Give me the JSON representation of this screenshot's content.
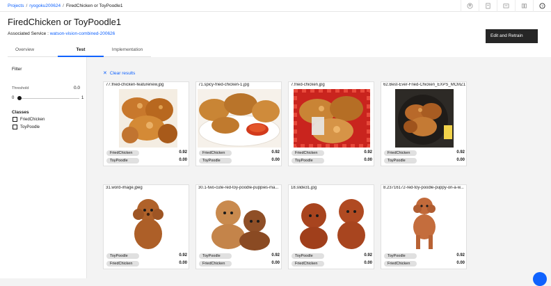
{
  "breadcrumb": {
    "projects": "Projects",
    "account": "ryogoku200624",
    "current": "FiredChicken or ToyPoodle1",
    "sep": "/"
  },
  "header": {
    "title": "FiredChicken or ToyPoodle1",
    "assoc_label": "Associated Service :",
    "assoc_link": "watson-vision-combined-200626",
    "retrain_label": "Edit and Retrain"
  },
  "tabs": [
    {
      "label": "Overview"
    },
    {
      "label": "Test"
    },
    {
      "label": "Implementation"
    }
  ],
  "topbar_icons": [
    "user-icon",
    "docs-icon",
    "messages-icon",
    "catalog-icon",
    "help-icon"
  ],
  "filter": {
    "title": "Filter",
    "threshold_label": "Threshold",
    "threshold_value": "0.0",
    "min": "0",
    "max": "1",
    "classes_title": "Classes",
    "classes": [
      {
        "label": "FriedChicken"
      },
      {
        "label": "ToyPoodle"
      }
    ]
  },
  "clear_label": "Clear results",
  "cards": [
    {
      "filename": "77.fried-chicken-featurenew.jpg",
      "results": [
        {
          "label": "FriedChicken",
          "score": "0.92"
        },
        {
          "label": "ToyPoodle",
          "score": "0.00"
        }
      ]
    },
    {
      "filename": "71.spicy-fried-chicken-1.jpg",
      "results": [
        {
          "label": "FriedChicken",
          "score": "0.92"
        },
        {
          "label": "ToyPoodle",
          "score": "0.00"
        }
      ]
    },
    {
      "filename": "7.fried-chicken.jpg",
      "results": [
        {
          "label": "FriedChicken",
          "score": "0.92"
        },
        {
          "label": "ToyPoodle",
          "score": "0.00"
        }
      ]
    },
    {
      "filename": "62.Best-Ever-Fried-Chicken_EXPS_MCMZ1...",
      "results": [
        {
          "label": "FriedChicken",
          "score": "0.92"
        },
        {
          "label": "ToyPoodle",
          "score": "0.00"
        }
      ]
    },
    {
      "filename": "31.word-image.jpeg",
      "results": [
        {
          "label": "ToyPoodle",
          "score": "0.92"
        },
        {
          "label": "FriedChicken",
          "score": "0.00"
        }
      ]
    },
    {
      "filename": "30.1-two-cute-red-toy-poodle-puppies-ma...",
      "results": [
        {
          "label": "ToyPoodle",
          "score": "0.92"
        },
        {
          "label": "FriedChicken",
          "score": "0.00"
        }
      ]
    },
    {
      "filename": "18.slide31.jpg",
      "results": [
        {
          "label": "ToyPoodle",
          "score": "0.92"
        },
        {
          "label": "FriedChicken",
          "score": "0.00"
        }
      ]
    },
    {
      "filename": "8.23716172-red-toy-poodle-puppy-on-a-w...",
      "results": [
        {
          "label": "ToyPoodle",
          "score": "0.92"
        },
        {
          "label": "FriedChicken",
          "score": "0.00"
        }
      ]
    }
  ],
  "colors": {
    "accent": "#0f62fe",
    "button_dark": "#262626",
    "tag_bg": "#e0e0e0"
  }
}
